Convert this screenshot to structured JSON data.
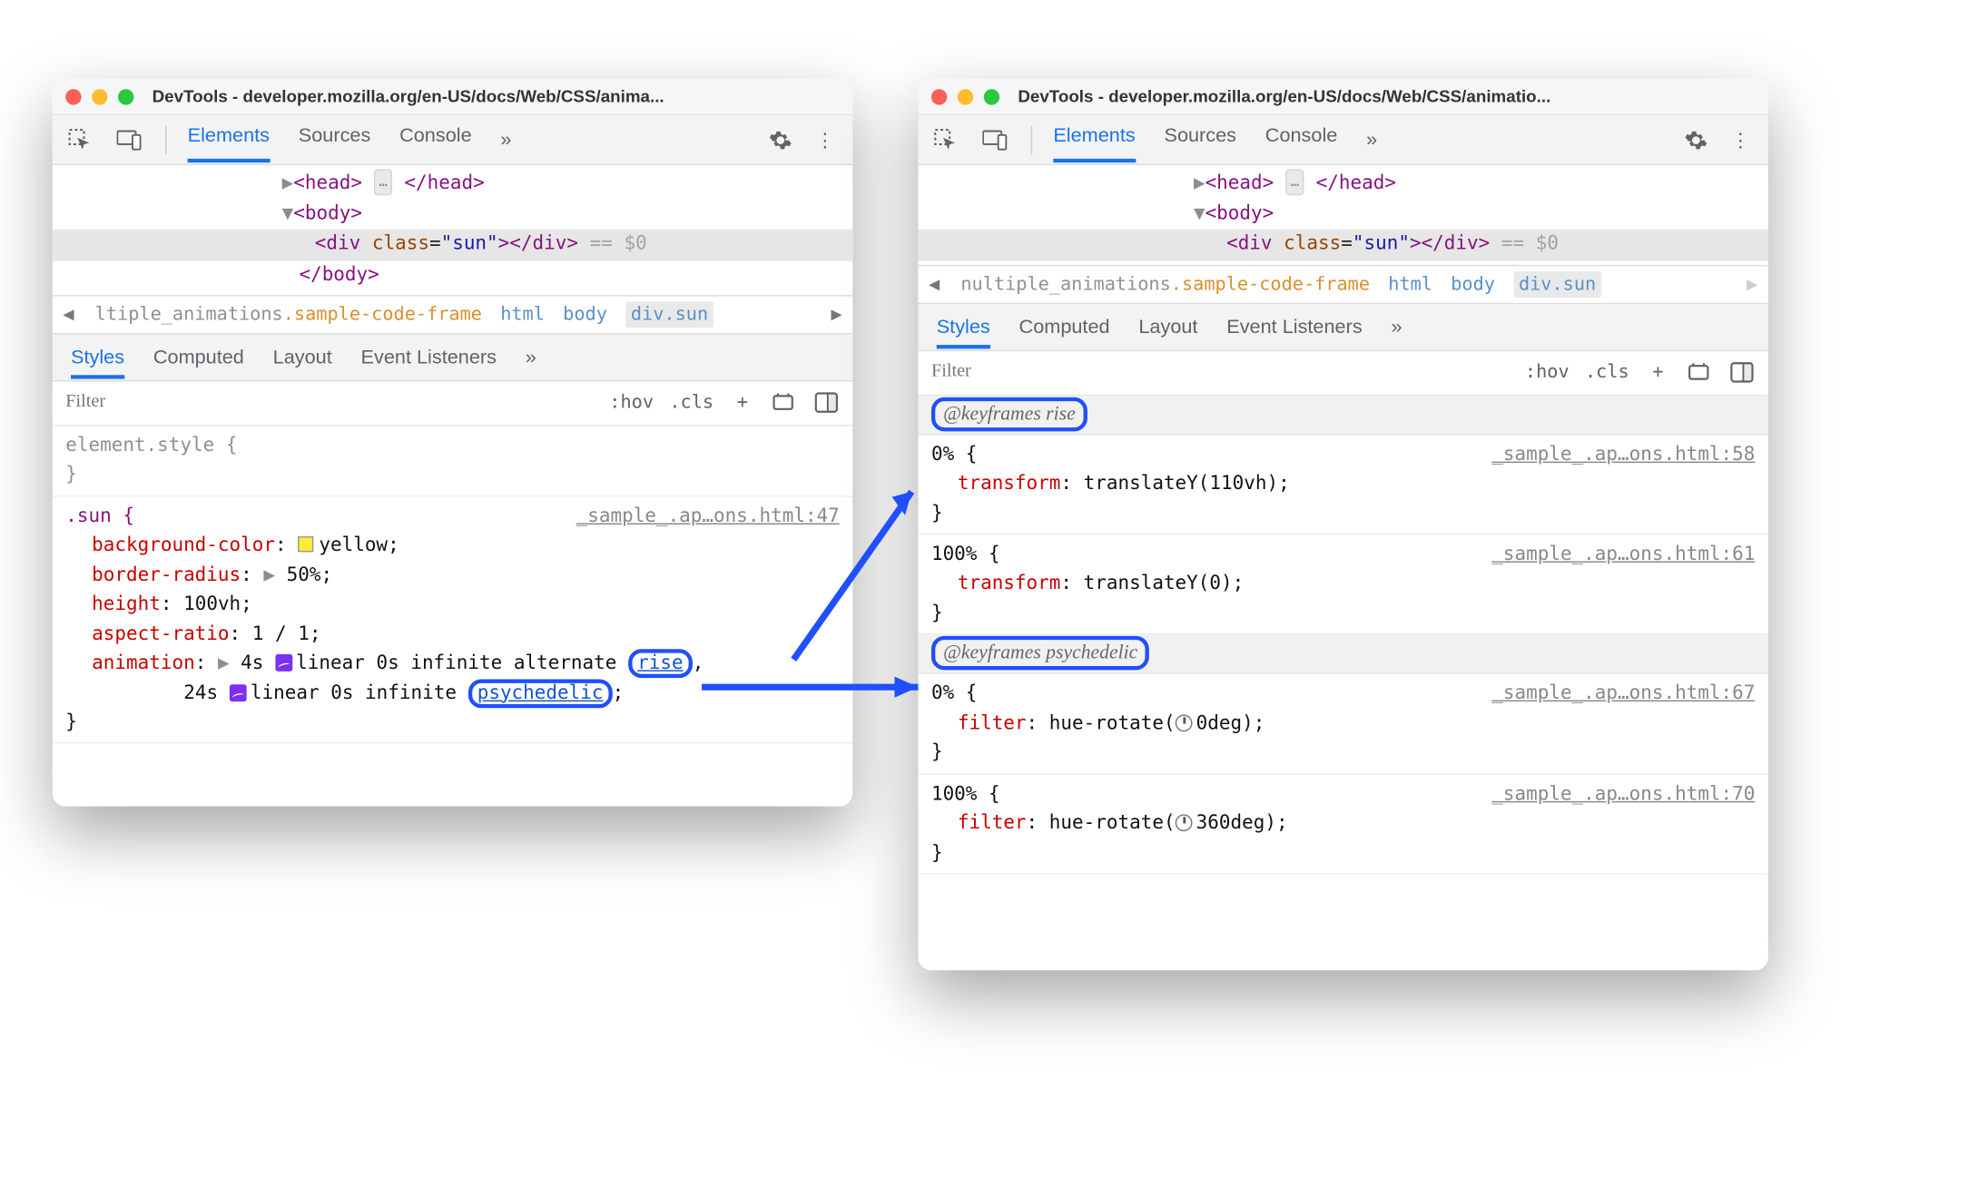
{
  "windows": {
    "left": {
      "title": "DevTools - developer.mozilla.org/en-US/docs/Web/CSS/anima..."
    },
    "right": {
      "title": "DevTools - developer.mozilla.org/en-US/docs/Web/CSS/animatio..."
    }
  },
  "toolbar": {
    "tabs": {
      "elements": "Elements",
      "sources": "Sources",
      "console": "Console"
    }
  },
  "dom": {
    "head_exp": "▶",
    "body_exp": "▼",
    "head_open": "<head>",
    "head_close": "</head>",
    "body_open": "<body>",
    "body_close": "</body>",
    "div_open_a": "<div ",
    "attr_class": "class",
    "attr_val": "\"sun\"",
    "div_open_b": ">",
    "div_close": "</div>",
    "eqzero": " == $0",
    "ellipsis": "…"
  },
  "breadcrumbs": {
    "left": {
      "prefix": "ltiple_animations",
      "frame": ".sample-code-frame",
      "items": [
        "html",
        "body",
        "div.sun"
      ]
    },
    "right": {
      "prefix": "nultiple_animations",
      "frame": ".sample-code-frame",
      "items": [
        "html",
        "body",
        "div.sun"
      ]
    }
  },
  "panelTabs": {
    "styles": "Styles",
    "computed": "Computed",
    "layout": "Layout",
    "listeners": "Event Listeners"
  },
  "filter": {
    "placeholder": "Filter",
    "hov": ":hov",
    "cls": ".cls",
    "plus": "+"
  },
  "leftStyles": {
    "element_style": "element.style {",
    "close": "}",
    "sun_selector": ".sun {",
    "src_sun": "_sample_.ap…ons.html:47",
    "p_bg": "background-color",
    "v_bg": "yellow",
    "p_br": "border-radius",
    "v_br": "50%",
    "p_h": "height",
    "v_h": "100vh",
    "p_ar": "aspect-ratio",
    "v_ar": "1 / 1",
    "p_anim": "animation",
    "v_anim_1_pre": "4s ",
    "v_anim_1_tf": "linear",
    "v_anim_1_mid": " 0s infinite alternate ",
    "v_anim_1_name": "rise",
    "v_anim_2_pre": "24s ",
    "v_anim_2_tf": "linear",
    "v_anim_2_mid": " 0s infinite ",
    "v_anim_2_name": "psychedelic",
    "tri": "▶"
  },
  "rightStyles": {
    "kf_rise": "@keyframes rise",
    "kf_psy": "@keyframes psychedelic",
    "pct0": "0% {",
    "pct100": "100% {",
    "close": "}",
    "p_tf": "transform",
    "v_tf0": "translateY(110vh)",
    "v_tf100": "translateY(0)",
    "p_flt": "filter",
    "v_flt0_a": "hue-rotate(",
    "v_flt0_b": "0deg)",
    "v_flt100_a": "hue-rotate(",
    "v_flt100_b": "360deg)",
    "src58": "_sample_.ap…ons.html:58",
    "src61": "_sample_.ap…ons.html:61",
    "src67": "_sample_.ap…ons.html:67",
    "src70": "_sample_.ap…ons.html:70"
  }
}
